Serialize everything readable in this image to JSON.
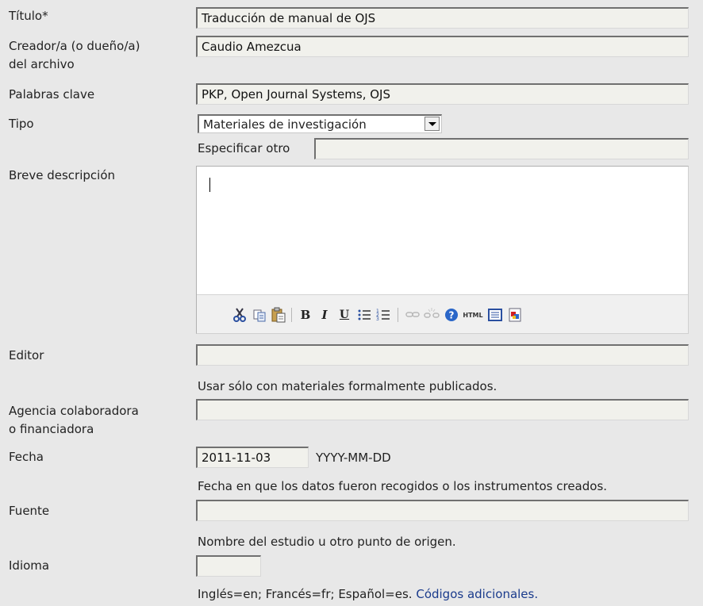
{
  "form": {
    "title": {
      "label": "Título*",
      "value": "Traducción de manual de OJS"
    },
    "creator": {
      "label_line1": "Creador/a (o dueño/a)",
      "label_line2": "del archivo",
      "value": "Caudio Amezcua"
    },
    "keywords": {
      "label": "Palabras clave",
      "value": "PKP, Open Journal Systems, OJS"
    },
    "type": {
      "label": "Tipo",
      "selected": "Materiales de investigación",
      "other_label": "Especificar otro",
      "other_value": ""
    },
    "description": {
      "label": "Breve descripción",
      "value": ""
    },
    "publisher": {
      "label": "Editor",
      "value": "",
      "note": "Usar sólo con materiales formalmente publicados."
    },
    "sponsor": {
      "label_line1": "Agencia colaboradora",
      "label_line2": "o financiadora",
      "value": ""
    },
    "date": {
      "label": "Fecha",
      "value": "2011-11-03",
      "format": "YYYY-MM-DD",
      "note": "Fecha en que los datos fueron recogidos o los instrumentos creados."
    },
    "source": {
      "label": "Fuente",
      "value": "",
      "note": "Nombre del estudio u otro punto de origen."
    },
    "language": {
      "label": "Idioma",
      "value": "",
      "note": "Inglés=en; Francés=fr; Español=es.",
      "link": "Códigos adicionales."
    }
  },
  "toolbar": {
    "buttons": [
      "cut-icon",
      "copy-icon",
      "paste-icon",
      "bold-icon",
      "italic-icon",
      "underline-icon",
      "bullet-list-icon",
      "numbered-list-icon",
      "link-icon",
      "unlink-icon",
      "help-icon",
      "html-icon",
      "fullscreen-icon",
      "image-icon"
    ],
    "bold_glyph": "B",
    "italic_glyph": "I",
    "underline_glyph": "U",
    "html_glyph": "HTML"
  },
  "colors": {
    "background": "#e8e8e8",
    "input_bg": "#f1f1ec",
    "link": "#1a3b8c",
    "help_blue": "#2a66c8"
  }
}
